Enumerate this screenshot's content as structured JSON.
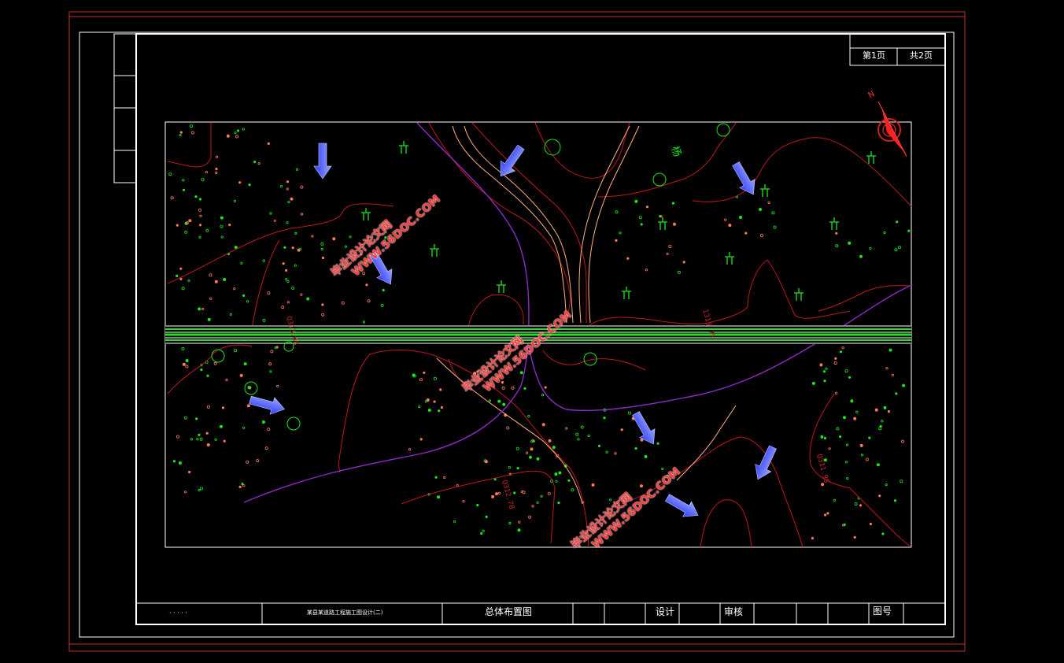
{
  "page": {
    "page_current": "第1页",
    "page_total": "共2页"
  },
  "map": {
    "north_label": "N",
    "place_label": "杨",
    "elevations": [
      "Q313.48",
      "1313.75",
      "Q312.78",
      "Q311.95"
    ]
  },
  "watermarks": [
    {
      "cn": "毕业设计论文网",
      "url": "WWW.56DOC.COM"
    },
    {
      "cn": "毕业设计论文网",
      "url": "WWW.56DOC.COM"
    },
    {
      "cn": "毕业设计论文网",
      "url": "WWW.56DOC.COM"
    }
  ],
  "title_block": {
    "designer_sig": "· · ·  · ·",
    "project": "某县某道路工程施工图设计(二)",
    "drawing_title": "总体布置图",
    "design_label": "设计",
    "review_label": "审核",
    "drawing_no_label": "图号"
  },
  "colors": {
    "background": "#000000",
    "outer_frame": "#c0302a",
    "inner_frame": "#ffffff",
    "contour": "#c01818",
    "road": "#18e818",
    "boundary": "#8a2bc8",
    "arrow": "#4a5cff",
    "vegetation": "#18e818"
  }
}
